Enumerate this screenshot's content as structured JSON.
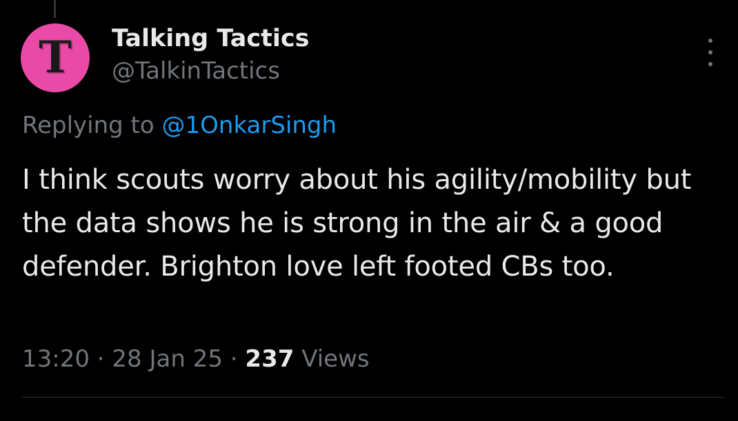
{
  "author": {
    "name": "Talking Tactics",
    "handle": "@TalkinTactics",
    "avatar_letter": "T",
    "avatar_color": "#ea4aa7"
  },
  "reply": {
    "prefix": "Replying to",
    "mention": "@1OnkarSingh"
  },
  "tweet": {
    "text": "I think scouts worry about his agility/mobility but the data shows he is strong in the air & a good defender. Brighton love left footed CBs too."
  },
  "meta": {
    "time": "13:20",
    "separator": "·",
    "date": "28 Jan 25",
    "views_count": "237",
    "views_label": "Views"
  },
  "icons": {
    "more": "more-options-icon"
  },
  "colors": {
    "background": "#000000",
    "text": "#e7e9ea",
    "secondary": "#71767b",
    "accent": "#1d9bf0"
  }
}
